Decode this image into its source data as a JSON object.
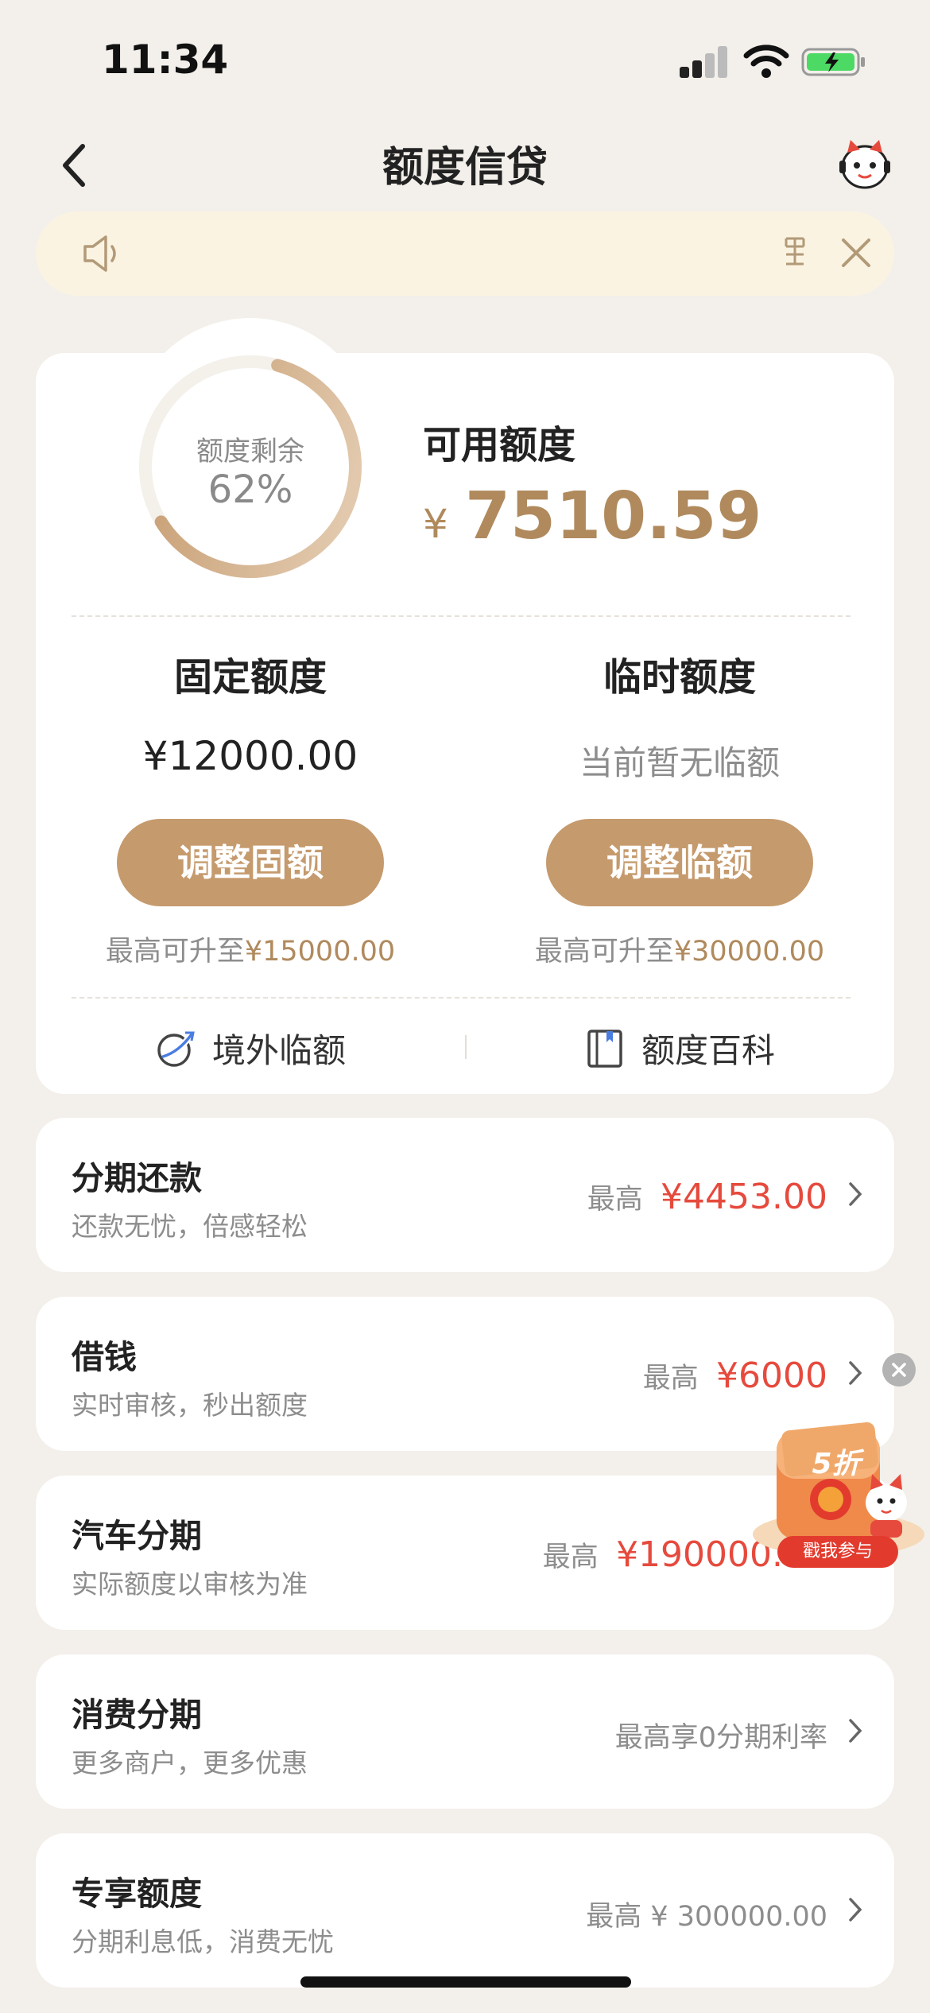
{
  "status_bar": {
    "time": "11:34"
  },
  "nav": {
    "title": "额度信贷"
  },
  "notice": {
    "more_glyph": "ʚ"
  },
  "credit": {
    "ring_label": "额度剩余",
    "ring_percent": "62%",
    "ring_fraction": 0.62,
    "available_label": "可用额度",
    "currency": "¥",
    "available_amount": "7510.59"
  },
  "fixed": {
    "title": "固定额度",
    "amount": "¥12000.00",
    "button": "调整固额",
    "hint_prefix": "最高可升至",
    "hint_value": "¥15000.00"
  },
  "temp": {
    "title": "临时额度",
    "status": "当前暂无临额",
    "button": "调整临额",
    "hint_prefix": "最高可升至",
    "hint_value": "¥30000.00"
  },
  "links": {
    "overseas": "境外临额",
    "wiki": "额度百科"
  },
  "products": [
    {
      "title": "分期还款",
      "subtitle": "还款无忧，倍感轻松",
      "prefix": "最高",
      "value": "¥4453.00"
    },
    {
      "title": "借钱",
      "subtitle": "实时审核，秒出额度",
      "prefix": "最高",
      "value": "¥6000"
    },
    {
      "title": "汽车分期",
      "subtitle": "实际额度以审核为准",
      "prefix": "最高",
      "value": "¥190000.00"
    },
    {
      "title": "消费分期",
      "subtitle": "更多商户，更多优惠",
      "prefix": "最高享0分期利率",
      "value": ""
    },
    {
      "title": "专享额度",
      "subtitle": "分期利息低，消费无忧",
      "prefix": "最高 ¥ 300000.00",
      "value": ""
    }
  ],
  "promo": {
    "discount": "5折",
    "cta": "戳我参与"
  },
  "colors": {
    "accent": "#c59a6d",
    "amount": "#b08a5d",
    "red": "#e64a3d",
    "background": "#f3efea"
  }
}
